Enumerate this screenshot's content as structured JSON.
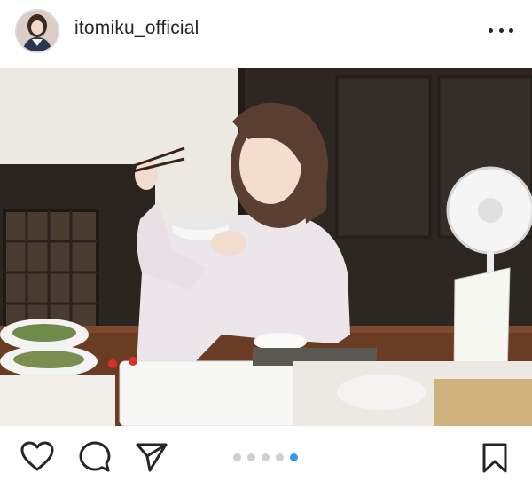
{
  "post": {
    "username": "itomiku_official",
    "carousel": {
      "total": 5,
      "active_index": 4
    }
  },
  "icons": {
    "more": "more-options-icon",
    "like": "heart-icon",
    "comment": "comment-icon",
    "share": "send-icon",
    "save": "bookmark-icon"
  },
  "colors": {
    "accent": "#3897f0",
    "text": "#262626",
    "dot_inactive": "#cfcfcf"
  }
}
